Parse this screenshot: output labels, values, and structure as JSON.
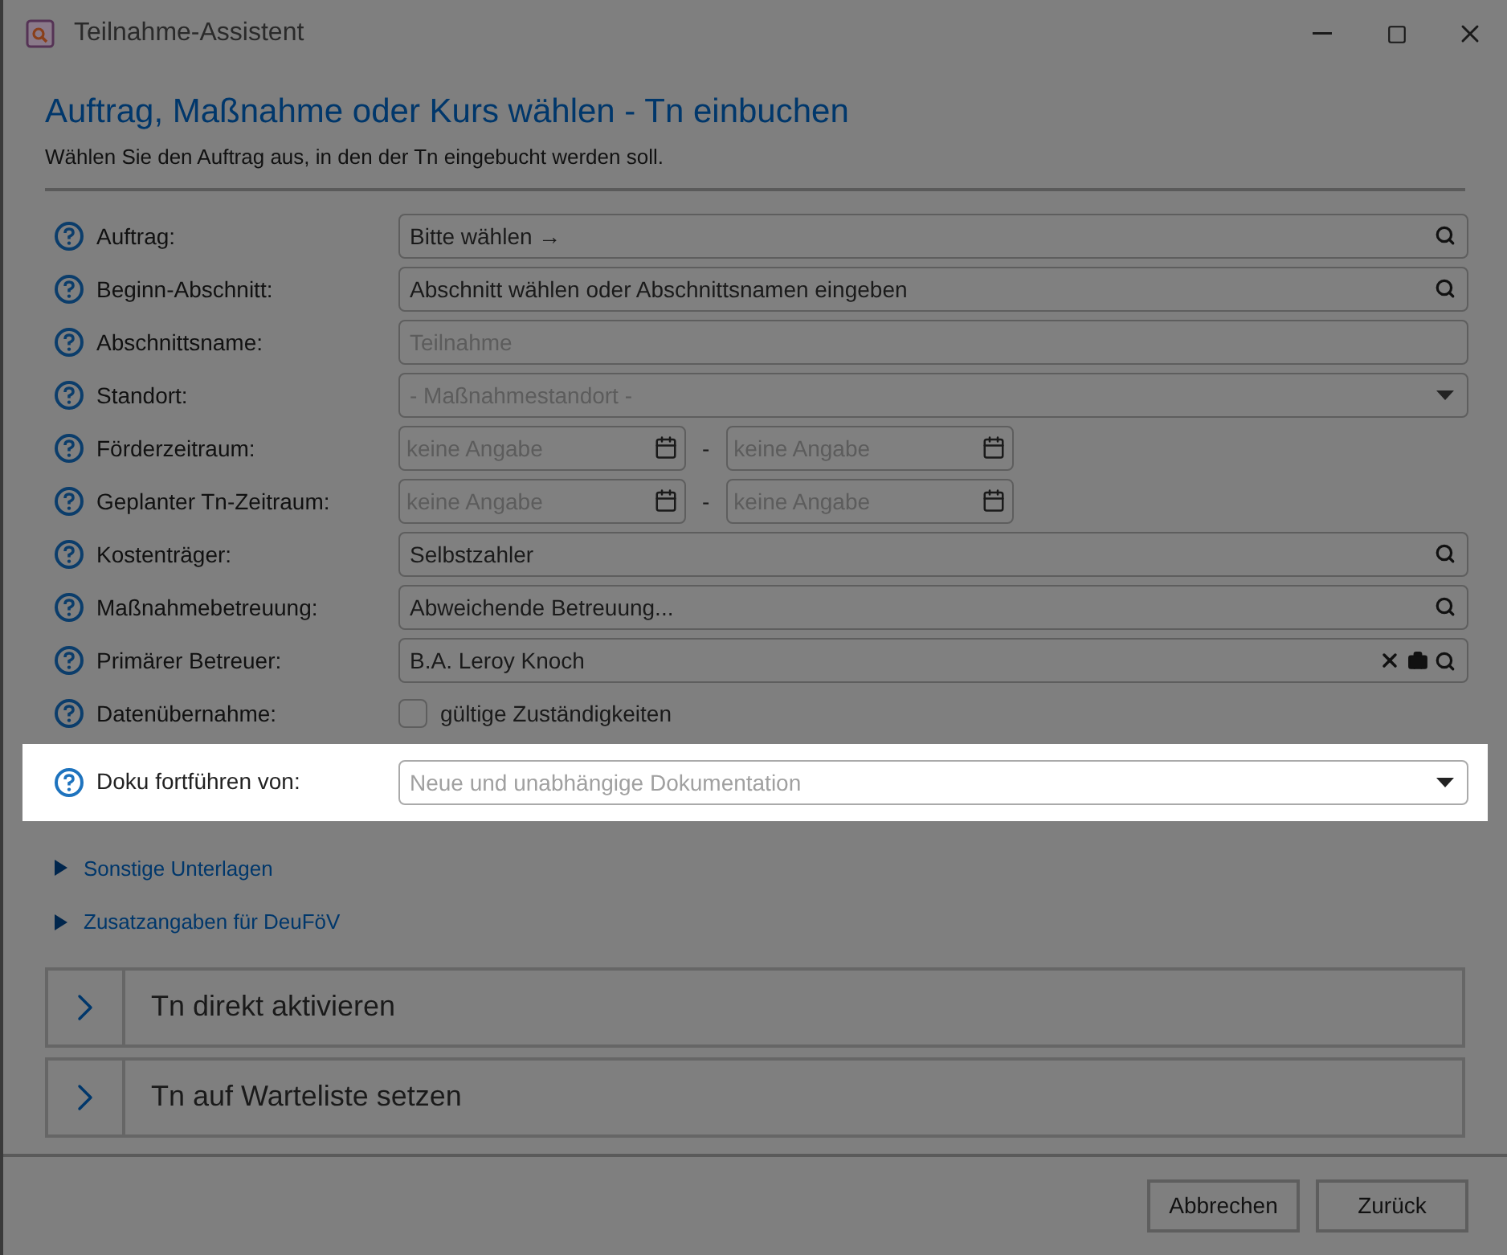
{
  "window": {
    "title": "Teilnahme-Assistent"
  },
  "header": {
    "title": "Auftrag, Maßnahme oder Kurs wählen - Tn einbuchen",
    "subtitle": "Wählen Sie den Auftrag aus, in den der Tn eingebucht werden soll."
  },
  "rows": [
    {
      "label": "Auftrag:",
      "kind": "search",
      "value": "Bitte wählen →",
      "highlighted": false
    },
    {
      "label": "Beginn-Abschnitt:",
      "kind": "search",
      "value": "Abschnitt wählen oder Abschnittsnamen eingeben",
      "highlighted": false
    },
    {
      "label": "Abschnittsname:",
      "kind": "text",
      "placeholder": "Teilnahme",
      "highlighted": false
    },
    {
      "label": "Standort:",
      "kind": "select",
      "placeholder": "- Maßnahmestandort -",
      "highlighted": false
    },
    {
      "label": "Förderzeitraum:",
      "kind": "daterange",
      "from_placeholder": "keine Angabe",
      "separator": "-",
      "to_placeholder": "keine Angabe",
      "highlighted": false
    },
    {
      "label": "Geplanter Tn-Zeitraum:",
      "kind": "daterange",
      "from_placeholder": "keine Angabe",
      "separator": "-",
      "to_placeholder": "keine Angabe",
      "highlighted": false
    },
    {
      "label": "Kostenträger:",
      "kind": "search",
      "value": "Selbstzahler",
      "highlighted": false
    },
    {
      "label": "Maßnahmebetreuung:",
      "kind": "search",
      "value": "Abweichende Betreuung...",
      "highlighted": false
    },
    {
      "label": "Primärer Betreuer:",
      "kind": "person",
      "value": "B.A. Leroy Knoch",
      "highlighted": false
    },
    {
      "label": "Datenübernahme:",
      "kind": "checkbox",
      "option": "gültige Zuständigkeiten",
      "checked": false,
      "highlighted": false
    },
    {
      "label": "Doku fortführen von:",
      "kind": "select",
      "placeholder": "Neue und unabhängige Dokumentation",
      "highlighted": true
    }
  ],
  "sections": [
    {
      "label": "Sonstige Unterlagen",
      "expanded": false
    },
    {
      "label": "Zusatzangaben für DeuFöV",
      "expanded": false
    }
  ],
  "actions": [
    "Tn direkt aktivieren",
    "Tn auf Warteliste setzen"
  ],
  "buttons": [
    "Abbrechen",
    "Zurück"
  ]
}
